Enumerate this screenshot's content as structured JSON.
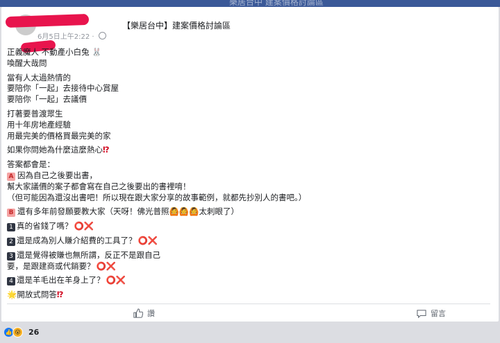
{
  "window": {
    "title": "樂居台中 建案價格討論區"
  },
  "post": {
    "author_redacted": true,
    "group_name": "【樂居台中】建案價格討論區",
    "timestamp": "6月5日上午2:22",
    "visibility": "·",
    "lines": {
      "l1": "正義魔人 不動產小白兔",
      "l2": "喚醒大哉問",
      "l3": "當有人太過熱情的",
      "l4": "要陪你「一起」去接待中心賞屋",
      "l5": "要陪你「一起」去議價",
      "l6": "打著要普渡眾生",
      "l7": "用十年房地產經驗",
      "l8": "用最完美的價格買最完美的家",
      "l9": "如果你問她為什麼這麼熱心",
      "l10": "答案都會是：",
      "l11_badge": "A",
      "l11": "因為自己之後要出書，",
      "l12": "幫大家議價的案子都會寫在自己之後要出的書裡唷！",
      "l13": "（但可能因為還沒出書吧！所以現在跟大家分享的故事範例，就都先抄別人的書吧。）",
      "l14_badge": "B",
      "l14a": "還有多年前發願要教大家（天呀！佛光普照",
      "l14b": "太刺眼了）",
      "q1_num": "1",
      "q1": "真的省錢了嗎？",
      "q2_num": "2",
      "q2": "還是成為別人賺介紹費的工具了？",
      "q3_num": "3",
      "q3a": "還是覺得被賺也無所謂，反正不是跟自己",
      "q3b": "要，是跟建商或代銷要？",
      "q4_num": "4",
      "q4": "還是羊毛出在羊身上了？",
      "l15": "開放式問答",
      "ox": "⭕❌"
    }
  },
  "actions": {
    "like_label": "讚",
    "comment_label": "留言"
  },
  "reactions": {
    "count": "26"
  },
  "colors": {
    "brand": "#3b5998",
    "link": "#1877f2",
    "redaction": "#e8144d"
  }
}
